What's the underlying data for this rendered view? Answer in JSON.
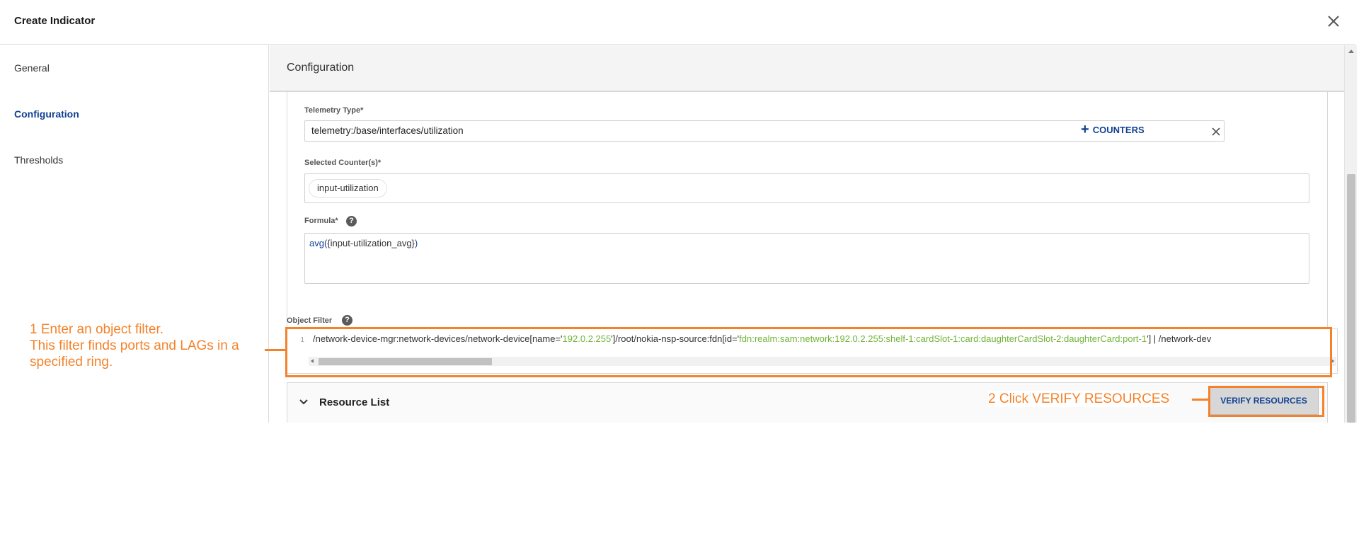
{
  "dialog": {
    "title": "Create Indicator"
  },
  "sidebar": {
    "items": [
      {
        "label": "General"
      },
      {
        "label": "Configuration"
      },
      {
        "label": "Thresholds"
      }
    ]
  },
  "section": {
    "title": "Configuration"
  },
  "telemetry": {
    "label": "Telemetry Type*",
    "value": "telemetry:/base/interfaces/utilization",
    "counters_button": "COUNTERS"
  },
  "counters": {
    "label": "Selected Counter(s)*",
    "chips": [
      "input-utilization"
    ]
  },
  "formula": {
    "label": "Formula*",
    "fn": "avg(",
    "arg": "{input-utilization_avg}",
    "close": ")"
  },
  "object_filter": {
    "label": "Object Filter",
    "line_number": "1",
    "seg1": "/network-device-mgr:network-devices/network-device[name='",
    "str1": "192.0.2.255",
    "seg2": "']/root/nokia-nsp-source:fdn[id='",
    "str2": "fdn:realm:sam:network:192.0.2.255:shelf-1:cardSlot-1:card:daughterCardSlot-2:daughterCard:port-1",
    "seg3": "'] | /network-dev"
  },
  "resource_list": {
    "label": "Resource List",
    "verify_button": "VERIFY RESOURCES"
  },
  "annotations": {
    "step1_line1": "1 Enter an object filter.",
    "step1_line2": "This filter finds ports and LAGs in a",
    "step1_line3": "specified ring.",
    "step2": "2 Click VERIFY RESOURCES"
  },
  "colors": {
    "accent": "#124191",
    "annotation": "#f4822a",
    "string_literal": "#6fb437"
  }
}
